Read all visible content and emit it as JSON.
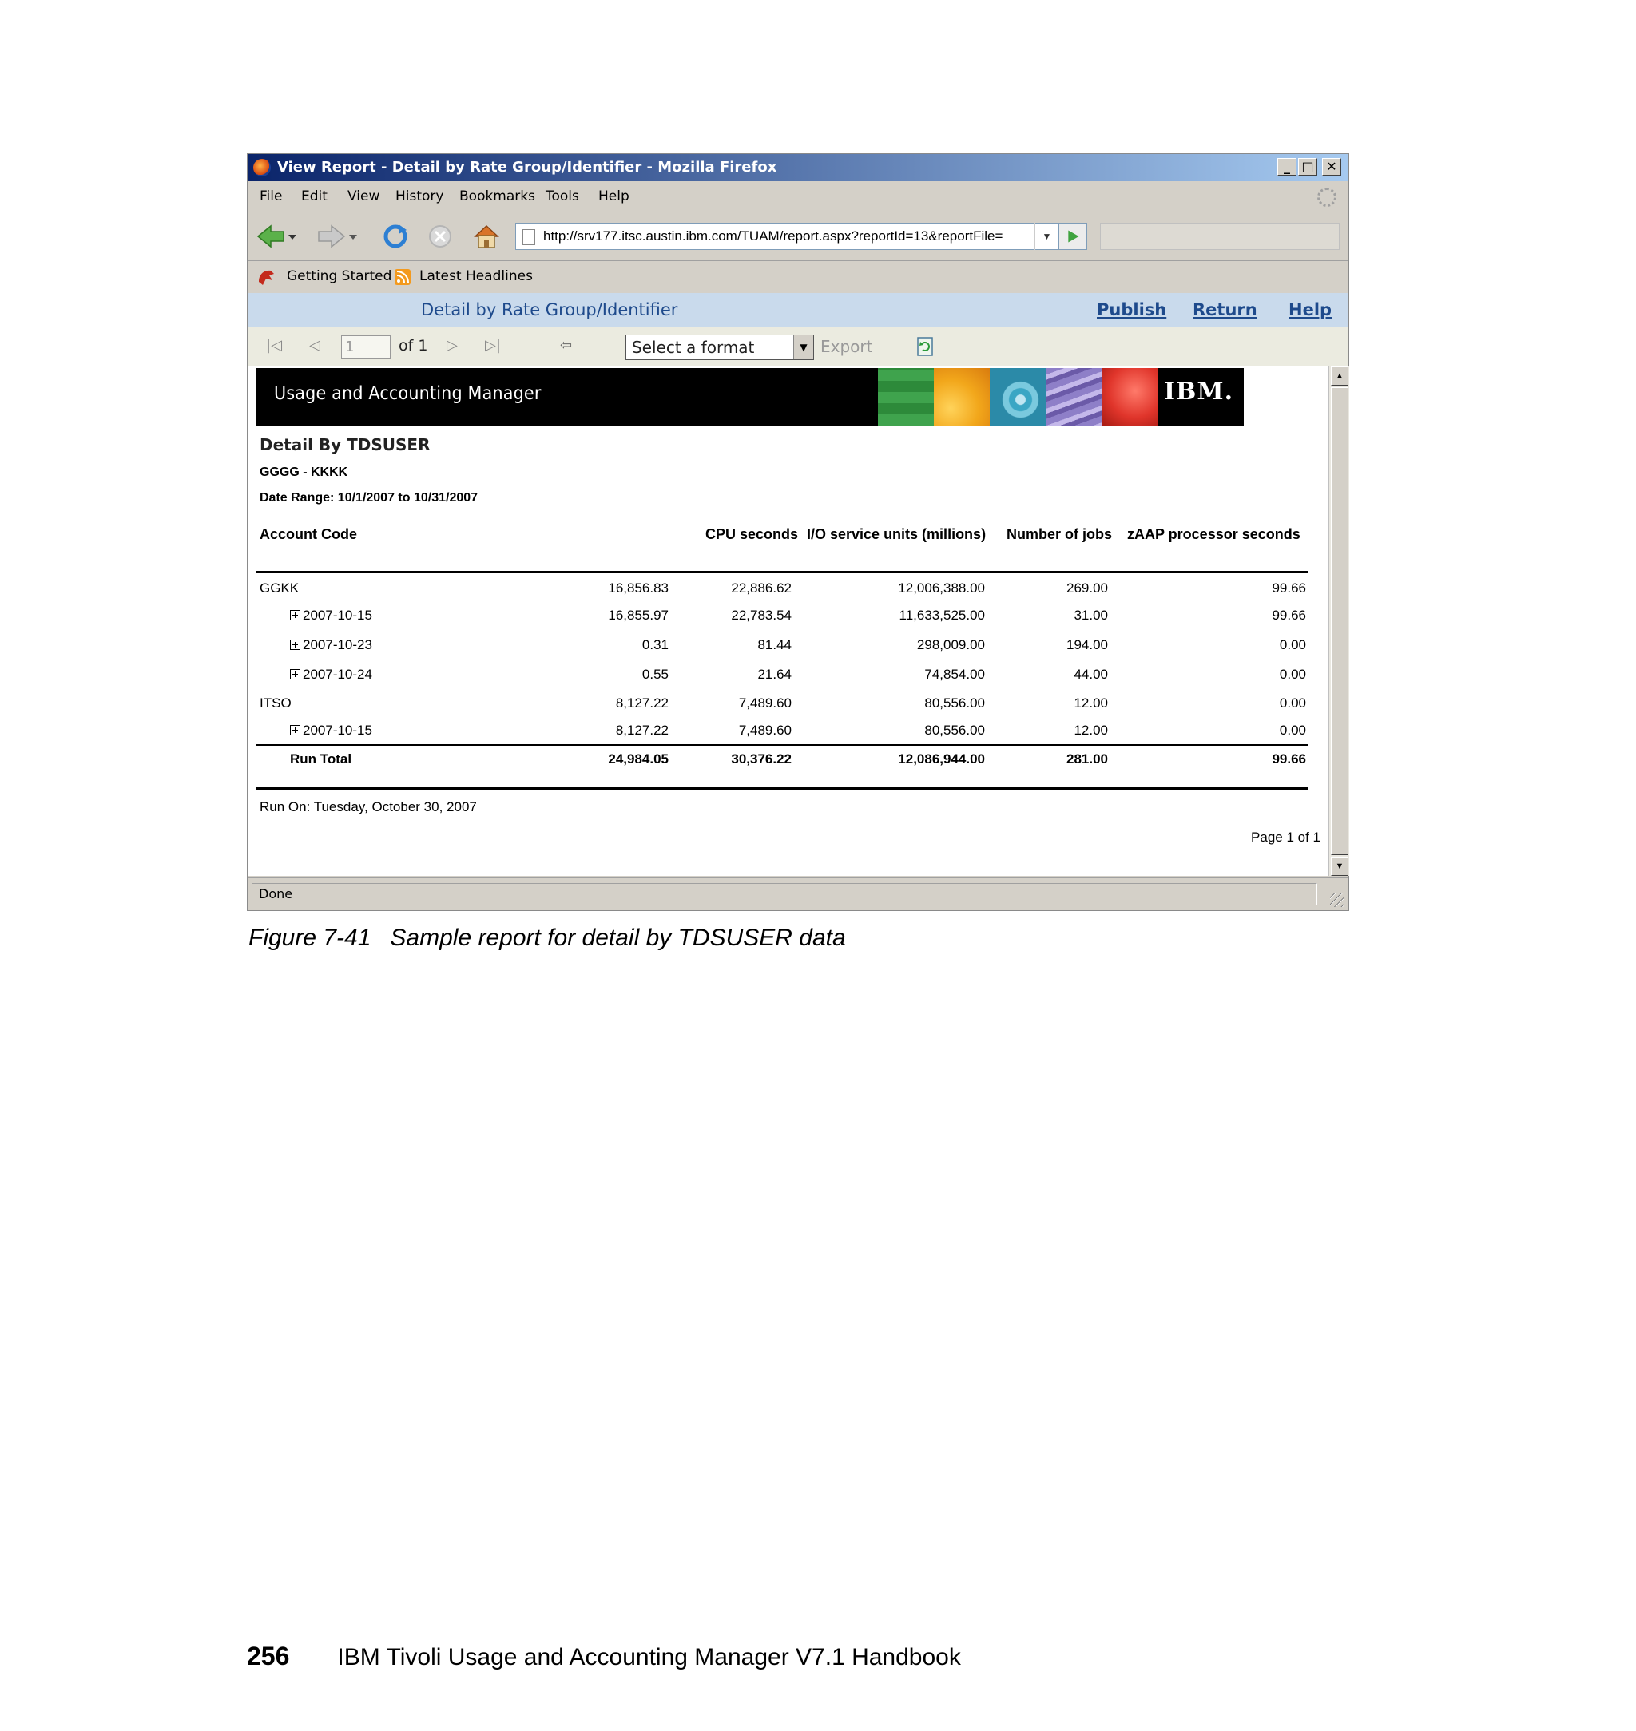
{
  "window": {
    "title": "View Report - Detail by Rate Group/Identifier - Mozilla Firefox",
    "min_label": "_",
    "max_label": "□",
    "close_label": "✕"
  },
  "menu": [
    "File",
    "Edit",
    "View",
    "History",
    "Bookmarks",
    "Tools",
    "Help"
  ],
  "nav": {
    "url": "http://srv177.itsc.austin.ibm.com/TUAM/report.aspx?reportId=13&reportFile=",
    "icons": [
      "back-arrow-icon",
      "forward-arrow-icon",
      "reload-icon",
      "stop-icon",
      "home-icon",
      "go-arrow-icon"
    ]
  },
  "bookmarks": {
    "getting_started": "Getting Started",
    "latest_headlines": "Latest Headlines"
  },
  "report_bar": {
    "title": "Detail by Rate Group/Identifier",
    "publish": "Publish",
    "return": "Return",
    "help": "Help"
  },
  "pager": {
    "page_value": "1",
    "of_label": "of 1",
    "format_placeholder": "Select a format",
    "export_label": "Export"
  },
  "banner": {
    "title": "Usage and Accounting Manager",
    "logo": "IBM.",
    "tile_colors": [
      "#3fa34d",
      "#f2a71b",
      "#3aa6c4",
      "#8e7fc8",
      "#e0352b"
    ]
  },
  "report": {
    "heading": "Detail By TDSUSER",
    "subheading": "GGGG - KKKK",
    "date_range": "Date Range: 10/1/2007 to 10/31/2007",
    "columns": [
      "Account Code",
      "CPU seconds",
      "I/O service units (millions)",
      "Number of jobs",
      "zAAP processor seconds"
    ],
    "rows": [
      {
        "label": "GGKK",
        "expand": false,
        "values": [
          "16,856.83",
          "22,886.62",
          "12,006,388.00",
          "269.00",
          "99.66"
        ]
      },
      {
        "label": "2007-10-15",
        "expand": true,
        "values": [
          "16,855.97",
          "22,783.54",
          "11,633,525.00",
          "31.00",
          "99.66"
        ]
      },
      {
        "label": "2007-10-23",
        "expand": true,
        "values": [
          "0.31",
          "81.44",
          "298,009.00",
          "194.00",
          "0.00"
        ]
      },
      {
        "label": "2007-10-24",
        "expand": true,
        "values": [
          "0.55",
          "21.64",
          "74,854.00",
          "44.00",
          "0.00"
        ]
      },
      {
        "label": "ITSO",
        "expand": false,
        "values": [
          "8,127.22",
          "7,489.60",
          "80,556.00",
          "12.00",
          "0.00"
        ]
      },
      {
        "label": "2007-10-15",
        "expand": true,
        "values": [
          "8,127.22",
          "7,489.60",
          "80,556.00",
          "12.00",
          "0.00"
        ]
      }
    ],
    "total": {
      "label": "Run Total",
      "values": [
        "24,984.05",
        "30,376.22",
        "12,086,944.00",
        "281.00",
        "99.66"
      ]
    },
    "run_on": "Run On: Tuesday, October 30, 2007",
    "page_of": "Page 1 of 1"
  },
  "status": "Done",
  "caption": {
    "figure": "Figure 7-41",
    "text": "Sample report for detail by TDSUSER data"
  },
  "footer": {
    "page_number": "256",
    "book_title": "IBM Tivoli Usage and Accounting Manager V7.1 Handbook"
  }
}
